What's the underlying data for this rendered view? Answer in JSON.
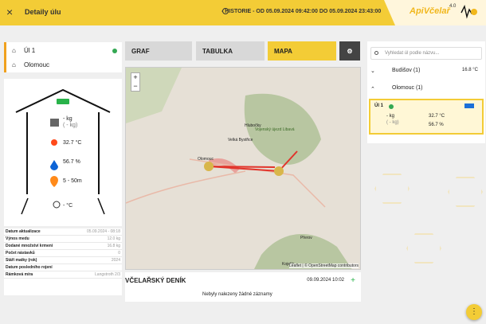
{
  "header": {
    "close_label": "×",
    "title": "Detaily úlu",
    "history": "- HISTORIE - OD 05.09.2024 09:42:00 DO 05.09.2024 23:43:00",
    "logo": {
      "name": "ApiVčelař",
      "version": "4.0"
    }
  },
  "hive": {
    "name": "Úl 1",
    "location": "Olomouc",
    "weight": "- kg",
    "weight_delta": "( - kg)",
    "temperature": "32.7 °C",
    "humidity": "56.7 %",
    "distance": "5 - 50m",
    "outside_temperature": "- °C"
  },
  "stats": [
    {
      "label": "Datum aktualizace",
      "value": "05.09.2024 - 08:18"
    },
    {
      "label": "Výnos medu",
      "value": "12.0 kg"
    },
    {
      "label": "Dodané množství krmení",
      "value": "16.8 kg"
    },
    {
      "label": "Počet nástavků",
      "value": "0"
    },
    {
      "label": "Stáří matky (rok)",
      "value": "2024"
    },
    {
      "label": "Datum posledního rojení",
      "value": ""
    },
    {
      "label": "Rámková míra",
      "value": "Langstroth 2/3"
    }
  ],
  "tabs": {
    "graph": "GRAF",
    "table": "TABULKA",
    "map": "MAPA"
  },
  "map": {
    "zoom_in": "+",
    "zoom_out": "−",
    "attribution": "Leaflet | © OpenStreetMap contributors",
    "labels": [
      "Olomouc",
      "Velká Bystřice",
      "Hlubočky",
      "Vojenský újezd Libavá",
      "Přerov",
      "Kojetín"
    ]
  },
  "diary": {
    "title": "VČELAŘSKÝ DENÍK",
    "date": "09.09.2024 10:02",
    "empty": "Nebyly nalezeny žádné záznamy"
  },
  "sidebar": {
    "search_placeholder": "Vyhledat úl podle názvu...",
    "groups": [
      {
        "label": "Budišov (1)",
        "temp": "16.8 °C"
      },
      {
        "label": "Olomouc (1)"
      }
    ],
    "selected": {
      "name": "Úl 1",
      "weight": "- kg",
      "weight_delta": "( - kg)",
      "temperature": "32.7 °C",
      "humidity": "56.7 %"
    }
  },
  "fab": "⋮"
}
